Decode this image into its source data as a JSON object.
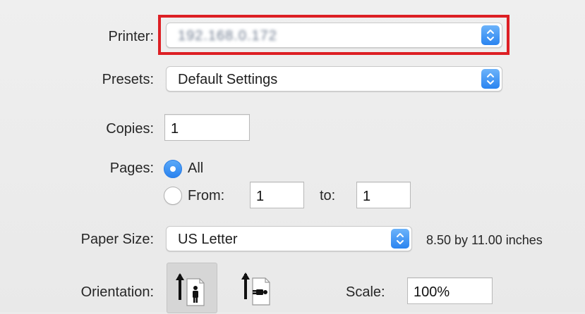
{
  "printer": {
    "label": "Printer:",
    "value": "192.168.0.172"
  },
  "presets": {
    "label": "Presets:",
    "value": "Default Settings"
  },
  "copies": {
    "label": "Copies:",
    "value": "1"
  },
  "pages": {
    "label": "Pages:",
    "all_label": "All",
    "from_label": "From:",
    "from_value": "1",
    "to_label": "to:",
    "to_value": "1",
    "selected": "All"
  },
  "paper_size": {
    "label": "Paper Size:",
    "value": "US Letter",
    "dimensions": "8.50 by 11.00 inches"
  },
  "orientation": {
    "label": "Orientation:",
    "selected": "portrait",
    "icons": [
      "portrait-orientation-icon",
      "landscape-orientation-icon"
    ]
  },
  "scale": {
    "label": "Scale:",
    "value": "100%"
  },
  "colors": {
    "accent": "#2a84f0",
    "highlight": "#dd1f24"
  }
}
